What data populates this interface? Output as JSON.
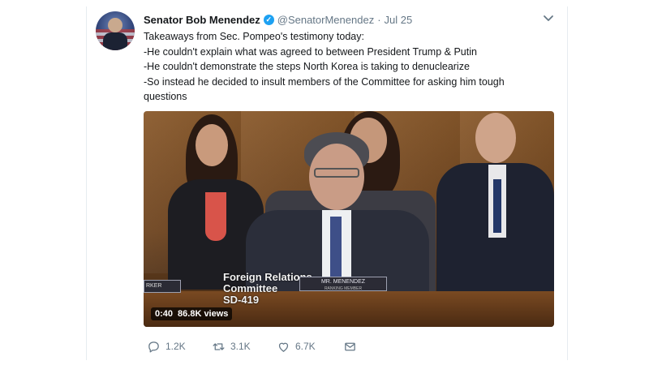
{
  "tweet": {
    "display_name": "Senator Bob Menendez",
    "verified_icon": "verified-badge-icon",
    "handle": "@SenatorMenendez",
    "separator": "·",
    "date": "Jul 25",
    "menu_icon": "chevron-down-icon",
    "text_lines": [
      "Takeaways from Sec. Pompeo's testimony today:",
      "-He couldn't explain what was agreed to between President Trump & Putin",
      "-He couldn't demonstrate the steps North Korea is taking to denuclearize",
      "-So instead he decided to insult members of the Committee for asking him tough",
      "questions"
    ]
  },
  "media": {
    "overlay_text_line1": "Foreign Relations",
    "overlay_text_line2": "Committee",
    "overlay_text_line3": "SD-419",
    "nameplate_line1": "MR. MENENDEZ",
    "nameplate_line2": "RANKING MEMBER",
    "left_nameplate": "RKER",
    "duration": "0:40",
    "views": "86.8K views"
  },
  "actions": {
    "reply_count": "1.2K",
    "retweet_count": "3.1K",
    "like_count": "6.7K",
    "reply_icon": "reply-icon",
    "retweet_icon": "retweet-icon",
    "like_icon": "heart-icon",
    "dm_icon": "envelope-icon"
  },
  "colors": {
    "verified": "#1da1f2",
    "text_primary": "#14171a",
    "text_secondary": "#657786"
  }
}
